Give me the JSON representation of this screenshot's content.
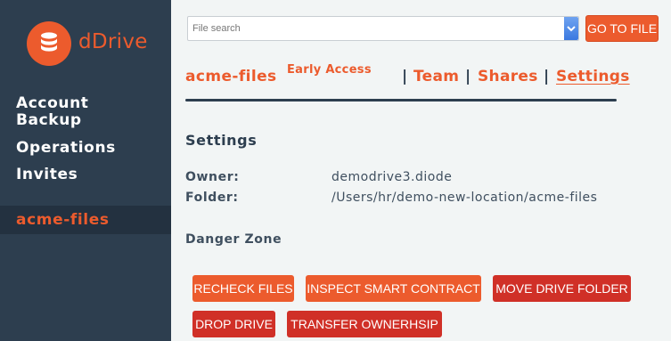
{
  "app": {
    "name": "dDrive",
    "logo_icon": "database-icon"
  },
  "sidebar": {
    "items": [
      {
        "label": "Account Backup"
      },
      {
        "label": "Operations"
      },
      {
        "label": "Invites"
      }
    ],
    "drives": [
      {
        "label": "acme-files",
        "active": true
      }
    ]
  },
  "search": {
    "placeholder": "File search",
    "value": "",
    "goto_label": "GO TO FILE"
  },
  "header": {
    "drive_name": "acme-files",
    "badge": "Early Access",
    "separator": "|",
    "tabs": [
      {
        "label": "Team"
      },
      {
        "label": "Shares"
      },
      {
        "label": "Settings",
        "active": true
      }
    ]
  },
  "settings": {
    "title": "Settings",
    "owner_label": "Owner:",
    "owner_value": "demodrive3.diode",
    "folder_label": "Folder:",
    "folder_value": "/Users/hr/demo-new-location/acme-files"
  },
  "danger": {
    "title": "Danger Zone",
    "buttons": [
      {
        "label": "RECHECK FILES"
      },
      {
        "label": "INSPECT SMART CONTRACT"
      },
      {
        "label": "MOVE DRIVE FOLDER"
      },
      {
        "label": "DROP DRIVE"
      },
      {
        "label": "TRANSFER OWNERHSIP"
      }
    ]
  },
  "colors": {
    "accent": "#ec5b2d",
    "danger": "#d03027",
    "sidebar": "#2d3e4f",
    "background": "#f2f5f5"
  }
}
